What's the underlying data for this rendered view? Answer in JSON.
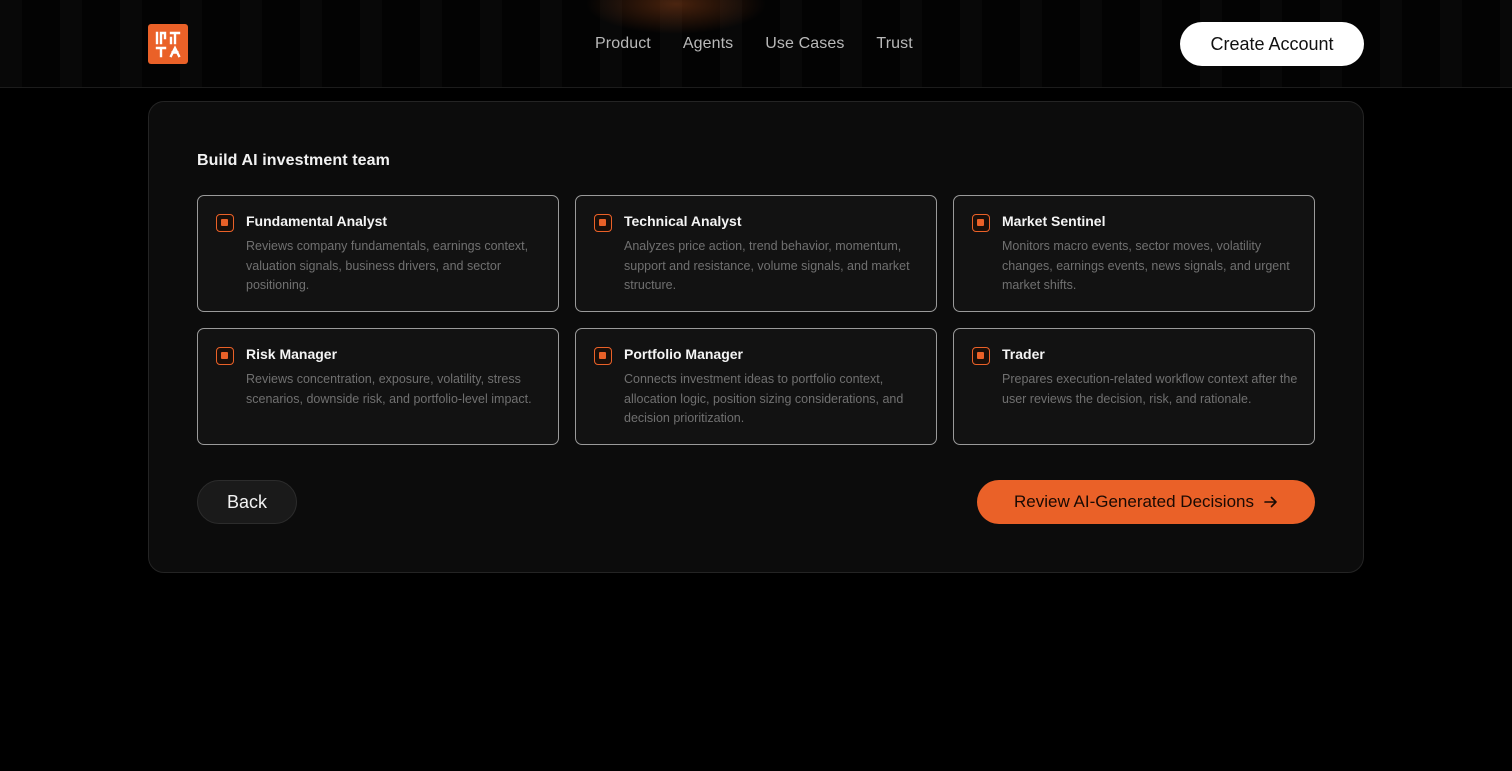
{
  "header": {
    "logo_icon": "brand-logo-icon",
    "nav": [
      {
        "label": "Product"
      },
      {
        "label": "Agents"
      },
      {
        "label": "Use Cases"
      },
      {
        "label": "Trust"
      }
    ],
    "cta_label": "Create Account"
  },
  "colors": {
    "accent": "#ea6128",
    "background": "#000000",
    "panel": "#0c0c0c"
  },
  "panel": {
    "title": "Build AI investment team",
    "agents": [
      {
        "title": "Fundamental Analyst",
        "description": "Reviews company fundamentals, earnings context, valuation signals, business drivers, and sector positioning.",
        "checked": true
      },
      {
        "title": "Technical Analyst",
        "description": "Analyzes price action, trend behavior, momentum, support and resistance, volume signals, and market structure.",
        "checked": true
      },
      {
        "title": "Market Sentinel",
        "description": "Monitors macro events, sector moves, volatility changes, earnings events, news signals, and urgent market shifts.",
        "checked": true
      },
      {
        "title": "Risk Manager",
        "description": "Reviews concentration, exposure, volatility, stress scenarios, downside risk, and portfolio-level impact.",
        "checked": true
      },
      {
        "title": "Portfolio Manager",
        "description": "Connects investment ideas to portfolio context, allocation logic, position sizing considerations, and decision prioritization.",
        "checked": true
      },
      {
        "title": "Trader",
        "description": "Prepares execution-related workflow context after the user reviews the decision, risk, and rationale.",
        "checked": true
      }
    ],
    "back_label": "Back",
    "review_label": "Review AI-Generated Decisions",
    "review_icon": "arrow-right-icon"
  }
}
